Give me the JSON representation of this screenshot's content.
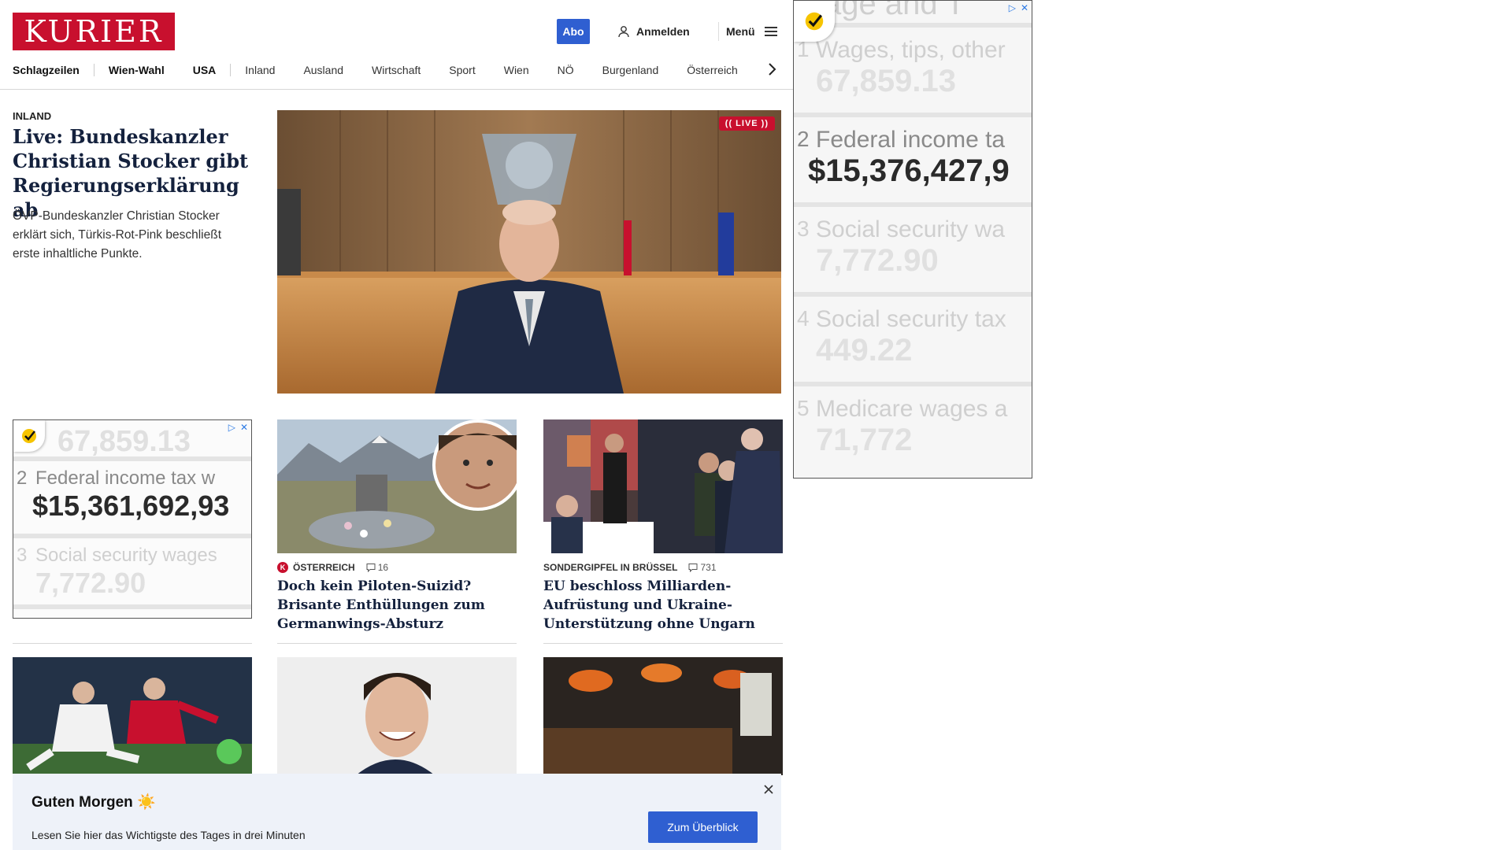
{
  "header": {
    "logo": "KURIER",
    "abo_label": "Abo",
    "login_label": "Anmelden",
    "menu_label": "Menü"
  },
  "nav": {
    "items": [
      "Schlagzeilen",
      "Wien-Wahl",
      "USA",
      "Inland",
      "Ausland",
      "Wirtschaft",
      "Sport",
      "Wien",
      "NÖ",
      "Burgenland",
      "Österreich"
    ]
  },
  "lead": {
    "category": "INLAND",
    "title": "Live: Bundeskanzler Christian Stocker gibt Regierungserklärung ab",
    "teaser": "ÖVP-Bundeskanzler Christian Stocker erklärt sich, Türkis-Rot-Pink beschließt erste inhaltliche Punkte.",
    "live_badge": "(( LIVE ))"
  },
  "ad_left": {
    "rows": [
      {
        "num": "",
        "label": "",
        "value": "67,859.13",
        "active": false
      },
      {
        "num": "2",
        "label": "Federal income tax w",
        "value": "$15,361,692,93",
        "active": true
      },
      {
        "num": "3",
        "label": "Social security wages",
        "value": "7,772.90",
        "active": false
      }
    ]
  },
  "ad_right": {
    "rows": [
      {
        "num": "",
        "label": "age and T",
        "value": "",
        "active": false
      },
      {
        "num": "1",
        "label": "Wages, tips, other",
        "value": "67,859.13",
        "active": false
      },
      {
        "num": "2",
        "label": "Federal income ta",
        "value": "$15,376,427,9",
        "active": true
      },
      {
        "num": "3",
        "label": "Social security wa",
        "value": "7,772.90",
        "active": false
      },
      {
        "num": "4",
        "label": "Social security tax",
        "value": "449.22",
        "active": false
      },
      {
        "num": "5",
        "label": "Medicare wages a",
        "value": "71,772",
        "active": false
      }
    ]
  },
  "cards": [
    {
      "category": "ÖSTERREICH",
      "comments": "16",
      "title": "Doch kein Piloten-Suizid? Brisante Enthüllungen zum Germanwings-Absturz"
    },
    {
      "category": "SONDERGIPFEL IN BRÜSSEL",
      "comments": "731",
      "title": "EU beschloss Milliarden-Aufrüstung und Ukraine-Unterstützung ohne Ungarn"
    }
  ],
  "notice": {
    "title": "Guten Morgen ☀️",
    "text": "Lesen Sie hier das Wichtigste des Tages in drei Minuten",
    "button": "Zum Überblick"
  },
  "colors": {
    "brand": "#c8102e",
    "accent": "#2f5fd1"
  }
}
